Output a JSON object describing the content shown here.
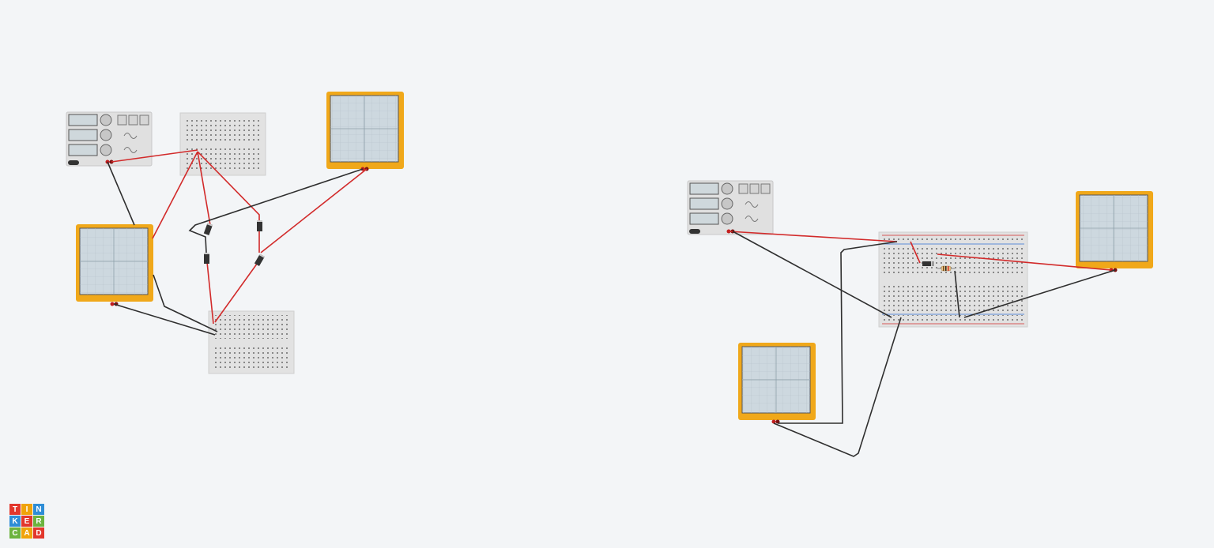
{
  "app": {
    "logo_letters": [
      "T",
      "I",
      "N",
      "K",
      "E",
      "R",
      "C",
      "A",
      "D"
    ],
    "logo_colors": [
      "#e2372c",
      "#f0a30a",
      "#2e8dd6",
      "#2e8dd6",
      "#e2372c",
      "#6cb33e",
      "#6cb33e",
      "#f0a30a",
      "#e2372c"
    ]
  },
  "colors": {
    "background": "#f3f5f7",
    "wire_red": "#d22a2a",
    "wire_black": "#2f2f2f",
    "oscilloscope_frame": "#f0a81a",
    "oscilloscope_screen": "#cdd8df",
    "breadboard": "#e0e0e0"
  },
  "circuit_left": {
    "components": [
      "function-generator",
      "breadboard-small",
      "oscilloscope",
      "oscilloscope",
      "breadboard-small",
      "diode",
      "diode",
      "diode",
      "diode"
    ]
  },
  "circuit_right": {
    "components": [
      "function-generator",
      "breadboard-full",
      "oscilloscope",
      "oscilloscope",
      "diode",
      "resistor"
    ]
  }
}
